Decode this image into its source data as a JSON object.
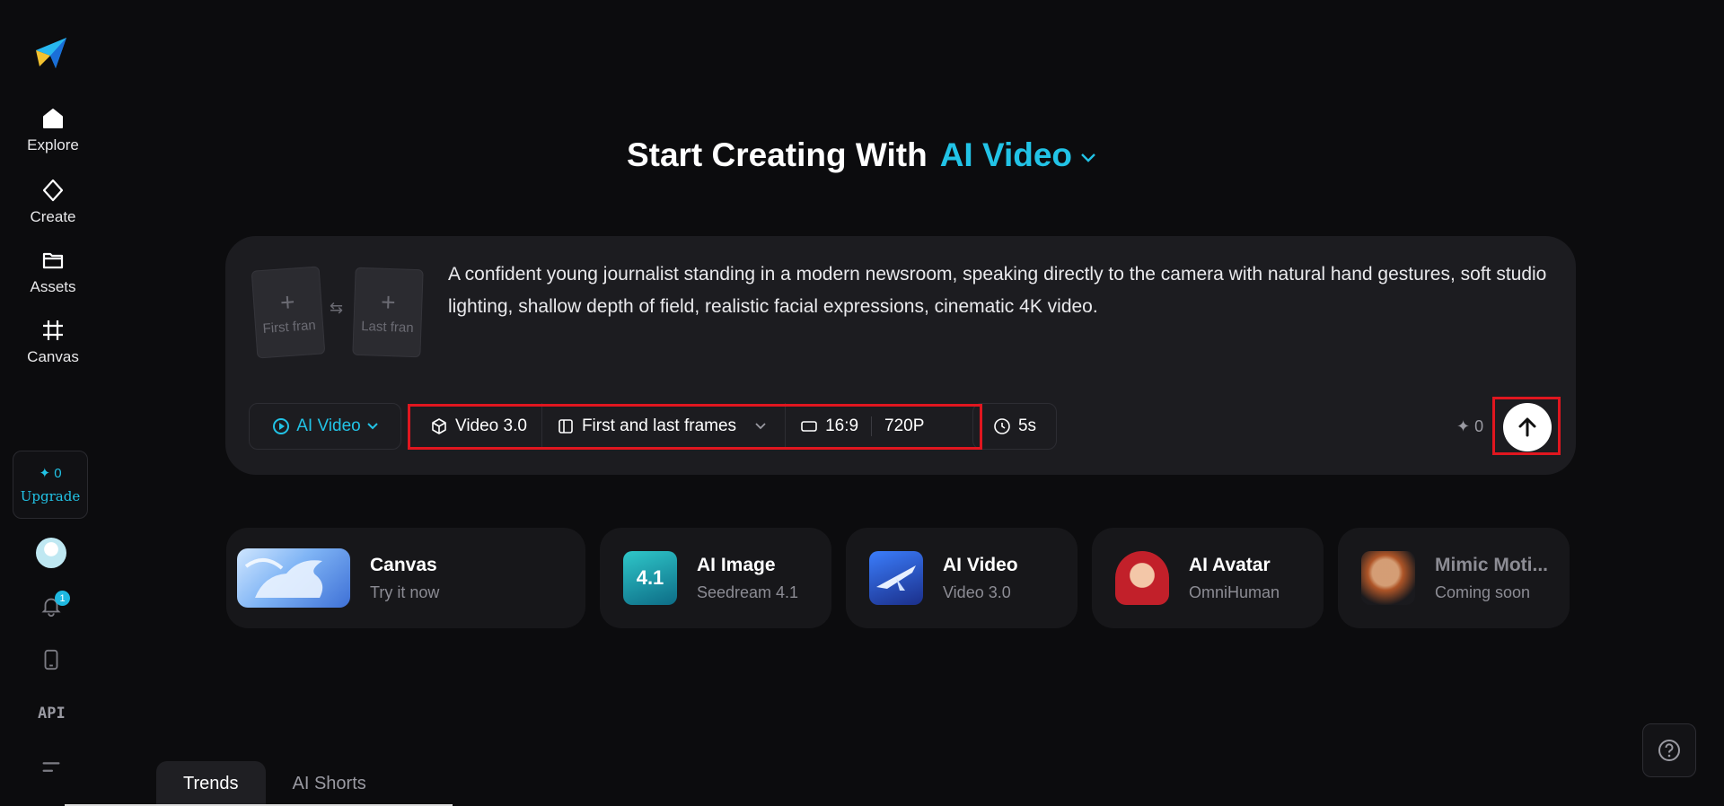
{
  "nav": {
    "items": [
      {
        "label": "Explore",
        "icon": "home-icon"
      },
      {
        "label": "Create",
        "icon": "diamond-icon"
      },
      {
        "label": "Assets",
        "icon": "folder-icon"
      },
      {
        "label": "Canvas",
        "icon": "canvas-frame-icon"
      }
    ],
    "upgrade": {
      "credits": "✦ 0",
      "label": "Upgrade"
    },
    "notifications_count": "1",
    "api_label": "API"
  },
  "headline": {
    "prefix": "Start Creating With",
    "accent": "AI Video"
  },
  "composer": {
    "first_frame_label": "First fran",
    "last_frame_label": "Last fran",
    "prompt": "A confident young journalist standing in a modern newsroom, speaking directly to the camera with natural hand gestures, soft studio lighting, shallow depth of field, realistic facial expressions, cinematic 4K video.",
    "mode_label": "AI Video",
    "model_version": "Video 3.0",
    "frame_mode": "First and last frames",
    "aspect_ratio": "16:9",
    "resolution": "720P",
    "duration": "5s",
    "credit_cost": "✦ 0"
  },
  "tiles": [
    {
      "title": "Canvas",
      "subtitle": "Try it now"
    },
    {
      "title": "AI Image",
      "subtitle": "Seedream 4.1",
      "thumb_text": "4.1"
    },
    {
      "title": "AI Video",
      "subtitle": "Video 3.0"
    },
    {
      "title": "AI Avatar",
      "subtitle": "OmniHuman"
    },
    {
      "title": "Mimic Moti...",
      "subtitle": "Coming soon"
    }
  ],
  "tabs": [
    {
      "label": "Trends",
      "active": true
    },
    {
      "label": "AI Shorts",
      "active": false
    }
  ],
  "colors": {
    "accent": "#22c3e6",
    "highlight_box": "#e0161f",
    "panel": "#1c1c20",
    "background": "#0c0c0e"
  }
}
